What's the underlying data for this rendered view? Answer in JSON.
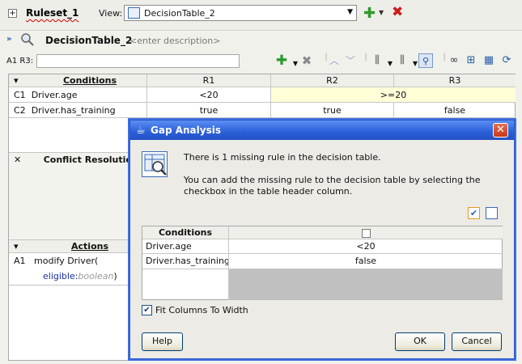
{
  "ruleset": {
    "title": "Ruleset_1",
    "toggle": "+"
  },
  "view": {
    "label": "View:",
    "selected": "DecisionTable_2"
  },
  "decision_table": {
    "name": "DecisionTable_2",
    "description_placeholder": "<enter description>"
  },
  "cell_ref": {
    "label": "A1 R3:",
    "value": ""
  },
  "grid": {
    "conditions_header": "Conditions",
    "rule_headers": [
      "R1",
      "R2",
      "R3"
    ],
    "condition_rows": [
      {
        "id": "C1",
        "label": "Driver.age",
        "r1": "<20",
        "r2r3": ">=20"
      },
      {
        "id": "C2",
        "label": "Driver.has_training",
        "r1": "true",
        "r2": "true",
        "r3": "false"
      }
    ],
    "conflict_header": "Conflict Resolution",
    "actions_header": "Actions",
    "action": {
      "id": "A1",
      "label": "modify Driver(",
      "param": "eligible:",
      "param_type": "boolean",
      "close": ")"
    }
  },
  "dialog": {
    "title": "Gap Analysis",
    "message1": "There is 1 missing rule in the decision table.",
    "message2": "You can add the missing rule to the decision table by selecting the checkbox in the table header column.",
    "table": {
      "conditions_header": "Conditions",
      "rows": [
        {
          "label": "Driver.age",
          "value": "<20"
        },
        {
          "label": "Driver.has_training",
          "value": "false"
        }
      ]
    },
    "fit_columns_label": "Fit Columns To Width",
    "fit_columns_checked": true,
    "help_label": "Help",
    "ok_label": "OK",
    "cancel_label": "Cancel"
  },
  "colors": {
    "titlebar": "#2a5fd8",
    "add": "#2c9a2c",
    "delete": "#cc1b1b",
    "highlight": "#ffffd8"
  }
}
